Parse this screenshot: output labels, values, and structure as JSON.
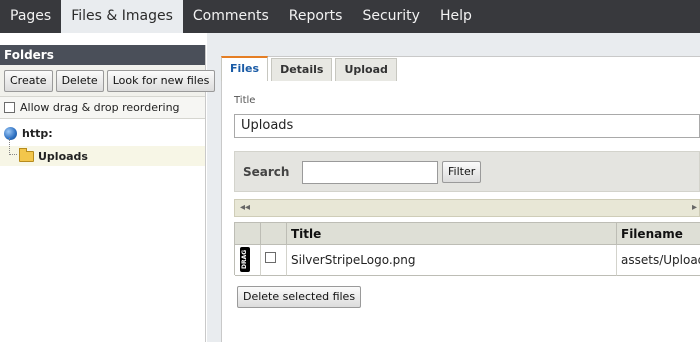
{
  "nav": {
    "tabs": [
      {
        "label": "Pages"
      },
      {
        "label": "Files & Images"
      },
      {
        "label": "Comments"
      },
      {
        "label": "Reports"
      },
      {
        "label": "Security"
      },
      {
        "label": "Help"
      }
    ],
    "active_index": 1
  },
  "sidebar": {
    "title": "Folders",
    "buttons": [
      "Create",
      "Delete",
      "Look for new files"
    ],
    "checkbox_label": "Allow drag & drop reordering",
    "tree": {
      "root_label": "http:",
      "children": [
        {
          "label": "Uploads"
        }
      ]
    }
  },
  "main": {
    "tabs": [
      "Files",
      "Details",
      "Upload"
    ],
    "active_tab": "Files",
    "title_label": "Title",
    "title_value": "Uploads",
    "search": {
      "label": "Search",
      "value": "",
      "filter_button": "Filter"
    },
    "table": {
      "columns": [
        "Title",
        "Filename"
      ],
      "rows": [
        {
          "drag_label": "DRAG",
          "title": "SilverStripeLogo.png",
          "filename": "assets/Upload"
        }
      ]
    },
    "delete_button": "Delete selected files"
  },
  "colors": {
    "nav_bg": "#38393d",
    "active_tab_accent": "#e57e24",
    "link_blue": "#1a5ba6"
  }
}
